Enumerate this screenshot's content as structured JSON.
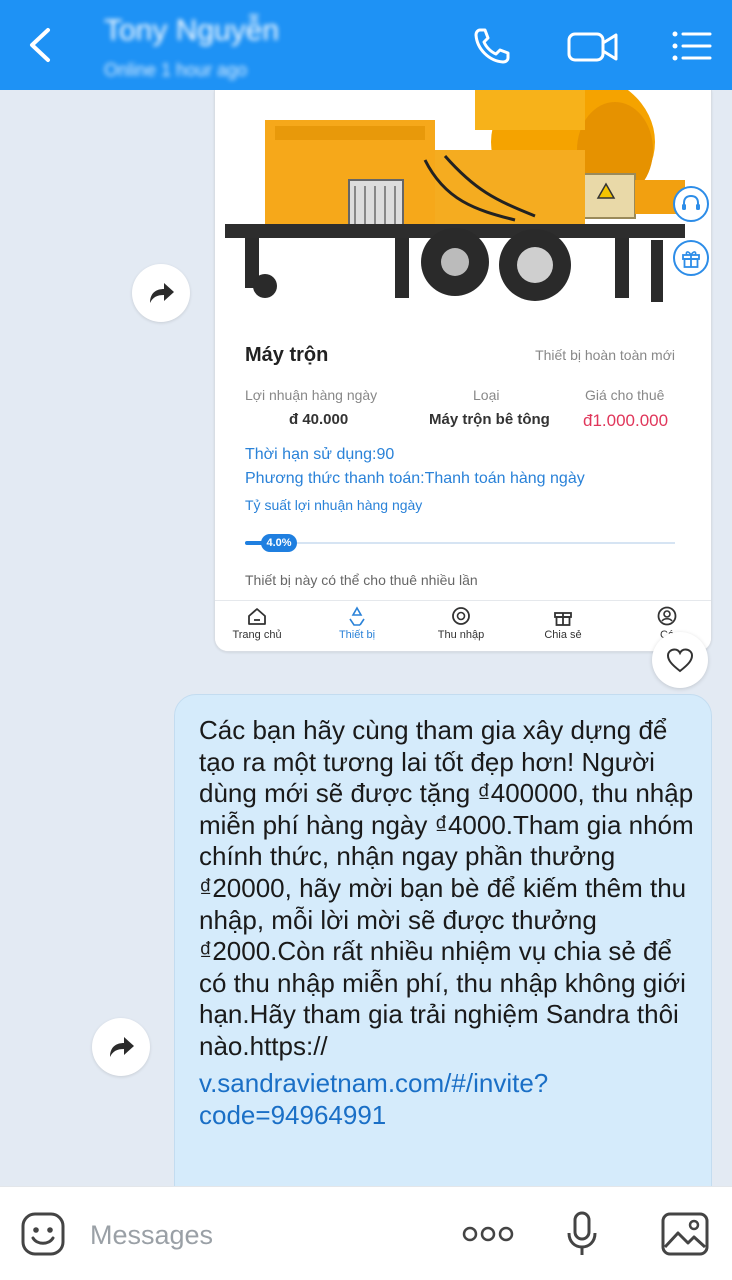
{
  "header": {
    "contact_name": "Tony Nguyễn",
    "status": "Online 1 hour ago",
    "bg_color": "#1e92f5"
  },
  "product_card": {
    "name": "Máy trộn",
    "condition": "Thiết bị hoàn toàn mới",
    "columns": [
      {
        "label": "Lợi nhuận hàng ngày",
        "value": "đ 40.000"
      },
      {
        "label": "Loại",
        "value": "Máy trộn bê tông"
      },
      {
        "label": "Giá cho thuê",
        "value": "đ1.000.000"
      }
    ],
    "usage_period": "Thời hạn sử dụng:90",
    "payment_method": "Phương thức thanh toán:Thanh toán hàng ngày",
    "yield_label": "Tỷ suất lợi nhuận hàng ngày",
    "yield_value": "4.0%",
    "yield_fraction": 0.04,
    "note": "Thiết bị này có thể cho thuê nhiều lần",
    "nav": [
      {
        "label": "Trang chủ",
        "icon": "home-icon",
        "active": false
      },
      {
        "label": "Thiết bị",
        "icon": "recycle-icon",
        "active": true
      },
      {
        "label": "Thu nhập",
        "icon": "income-icon",
        "active": false
      },
      {
        "label": "Chia sẻ",
        "icon": "gift-icon",
        "active": false
      },
      {
        "label": "Cá",
        "icon": "profile-icon",
        "active": false
      }
    ],
    "side_icons": [
      "headset-icon",
      "gift-icon"
    ]
  },
  "message": {
    "text": "Các bạn hãy cùng tham gia xây dựng để tạo ra một tương lai tốt đẹp hơn! Người dùng mới sẽ được tặng ₫400000, thu nhập miễn phí hàng ngày ₫4000.Tham gia nhóm chính thức, nhận ngay phần thưởng ₫20000, hãy mời bạn bè để kiếm thêm thu nhập, mỗi lời mời sẽ được thưởng ₫2000.Còn rất nhiều nhiệm vụ chia sẻ để có thu nhập miễn phí, thu nhập không giới hạn.Hãy tham gia trải nghiệm Sandra thôi nào.https://",
    "link": "v.sandravietnam.com/#/invite?code=94964991"
  },
  "composer": {
    "placeholder": "Messages"
  },
  "colors": {
    "bubble": "#d5ebfb",
    "link": "#1a6fc6",
    "price": "#e0365a",
    "accent": "#2a82d8"
  }
}
